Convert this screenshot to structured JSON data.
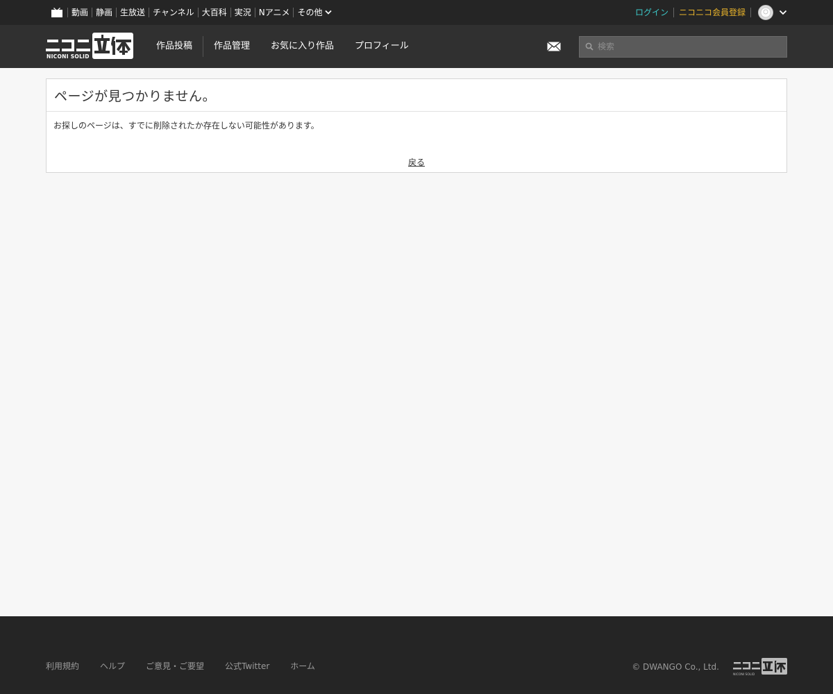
{
  "site_bar": {
    "links": [
      "動画",
      "静画",
      "生放送",
      "チャンネル",
      "大百科",
      "実況",
      "Nアニメ"
    ],
    "more_label": "その他",
    "login_label": "ログイン",
    "register_label": "ニコニコ会員登録"
  },
  "header": {
    "logo_text": "ニコニ立体",
    "logo_sub": "NICONI SOLID",
    "nav": [
      "作品投稿",
      "作品管理",
      "お気に入り作品",
      "プロフィール"
    ],
    "search_placeholder": "検索"
  },
  "main": {
    "title": "ページが見つかりません。",
    "message": "お探しのページは、すでに削除されたか存在しない可能性があります。",
    "back_label": "戻る"
  },
  "footer": {
    "links": [
      "利用規約",
      "ヘルプ",
      "ご意見・ご要望",
      "公式Twitter",
      "ホーム"
    ],
    "copyright": "© DWANGO Co., Ltd."
  },
  "colors": {
    "login": "#3cc8c8",
    "register": "#e8b32b",
    "header_bg": "#303030",
    "site_bar_bg": "#252525"
  }
}
